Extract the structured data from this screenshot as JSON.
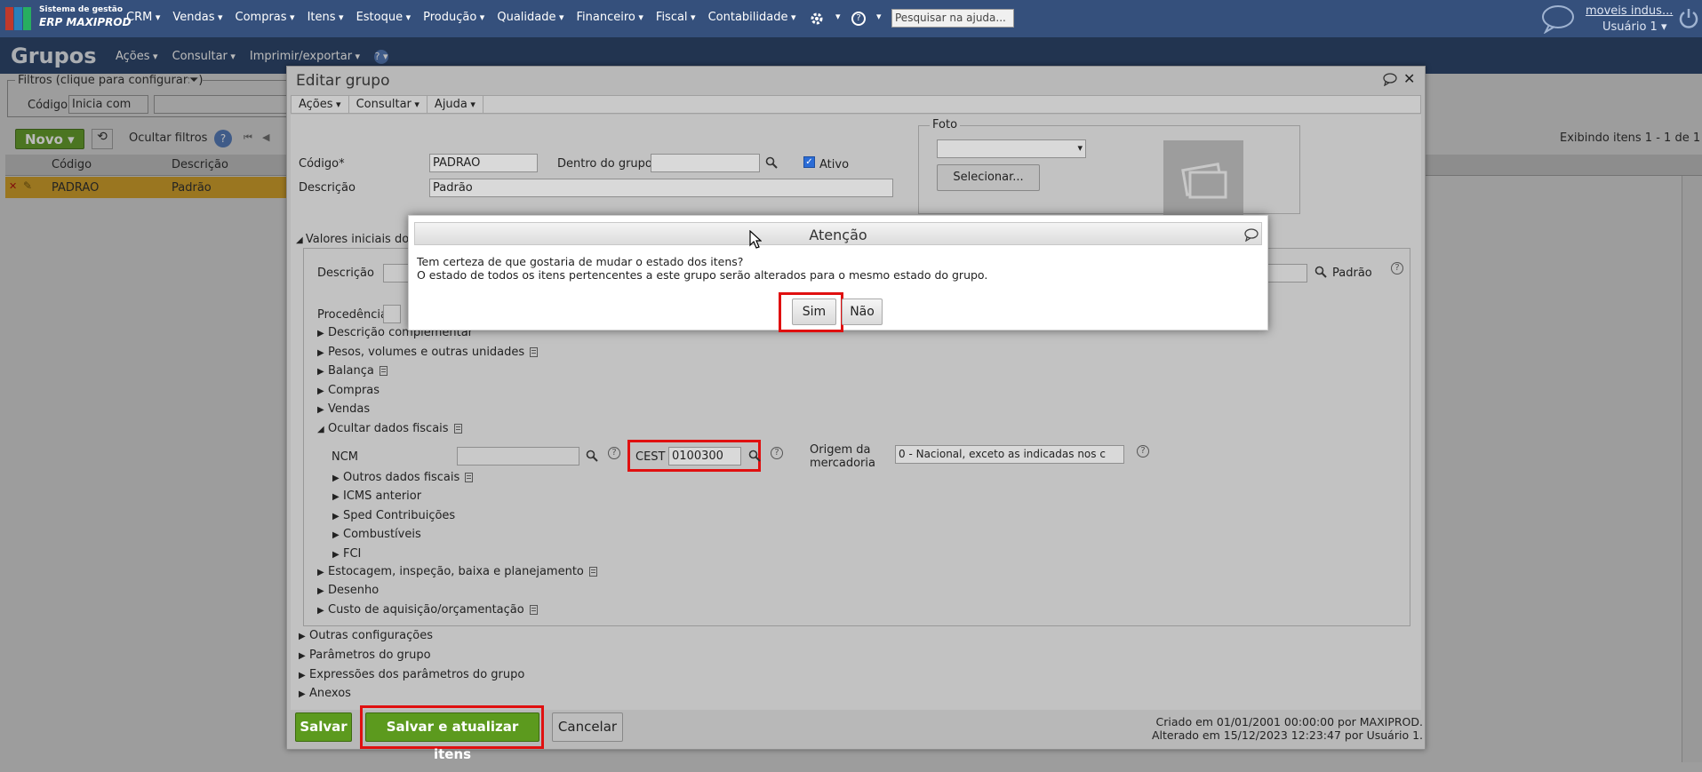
{
  "app": {
    "logo_line1": "Sistema de gestão",
    "logo_line2": "ERP MAXIPROD",
    "menu": [
      "CRM",
      "Vendas",
      "Compras",
      "Itens",
      "Estoque",
      "Produção",
      "Qualidade",
      "Financeiro",
      "Fiscal",
      "Contabilidade"
    ],
    "help_search_placeholder": "Pesquisar na ajuda...",
    "company_link": "moveis indus...",
    "user": "Usuário 1 ▾"
  },
  "page": {
    "title": "Grupos",
    "actions": [
      "Ações",
      "Consultar",
      "Imprimir/exportar"
    ],
    "filters_legend": "Filtros (clique para configurar:",
    "filter_code_label": "Código",
    "filter_code_mode": "Inicia com",
    "new_button": "Novo",
    "hide_filters": "Ocultar filtros",
    "showing": "Exibindo itens 1 - 1 de 1",
    "grid_headers": [
      "Código",
      "Descrição"
    ],
    "grid_rows": [
      {
        "code": "PADRAO",
        "desc": "Padrão"
      }
    ]
  },
  "edit": {
    "title": "Editar grupo",
    "toolbar": [
      "Ações",
      "Consultar",
      "Ajuda"
    ],
    "code_label": "Código*",
    "code_value": "PADRAO",
    "inside_group_label": "Dentro do grupo",
    "inside_group_value": "",
    "active_label": "Ativo",
    "desc_label": "Descrição",
    "desc_value": "Padrão",
    "photo_legend": "Foto",
    "photo_select": "Selecionar...",
    "initial_values": "Valores iniciais dos",
    "inner_desc_label": "Descrição",
    "inner_desc_tail": "Padrão",
    "proc_label": "Procedência",
    "tree": [
      {
        "label": "Descrição complementar",
        "doc": false
      },
      {
        "label": "Pesos, volumes e outras unidades",
        "doc": true
      },
      {
        "label": "Balança",
        "doc": true
      },
      {
        "label": "Compras",
        "doc": false
      },
      {
        "label": "Vendas",
        "doc": false
      },
      {
        "label": "Ocultar dados fiscais",
        "doc": true
      }
    ],
    "ncm_label": "NCM",
    "cest_label": "CEST",
    "cest_value": "0100300",
    "origin_label": "Origem da mercadoria",
    "origin_value": "0 - Nacional, exceto as indicadas nos c",
    "fiscal_sub": [
      {
        "label": "Outros dados fiscais",
        "doc": true
      },
      {
        "label": "ICMS anterior",
        "doc": false
      },
      {
        "label": "Sped Contribuições",
        "doc": false
      },
      {
        "label": "Combustíveis",
        "doc": false
      },
      {
        "label": "FCI",
        "doc": false
      }
    ],
    "tree_after": [
      {
        "label": "Estocagem, inspeção, baixa e planejamento",
        "doc": true
      },
      {
        "label": "Desenho",
        "doc": false
      },
      {
        "label": "Custo de aquisição/orçamentação",
        "doc": true
      }
    ],
    "outer_sections": [
      "Outras configurações",
      "Parâmetros do grupo",
      "Expressões dos parâmetros do grupo",
      "Anexos"
    ],
    "save": "Salvar",
    "save_update": "Salvar e atualizar itens",
    "cancel": "Cancelar",
    "created": "Criado em 01/01/2001 00:00:00 por MAXIPROD.",
    "altered": "Alterado em 15/12/2023 12:23:47 por Usuário 1."
  },
  "confirm": {
    "title": "Atenção",
    "line1": "Tem certeza de que gostaria de mudar o estado dos itens?",
    "line2": "O estado de todos os itens pertencentes a este grupo serão alterados para o mesmo estado do grupo.",
    "yes": "Sim",
    "no": "Não"
  },
  "colors": {
    "nav": "#35507c",
    "header": "#1f3a63",
    "highlight": "#e01010",
    "green": "#5c9a1e"
  }
}
